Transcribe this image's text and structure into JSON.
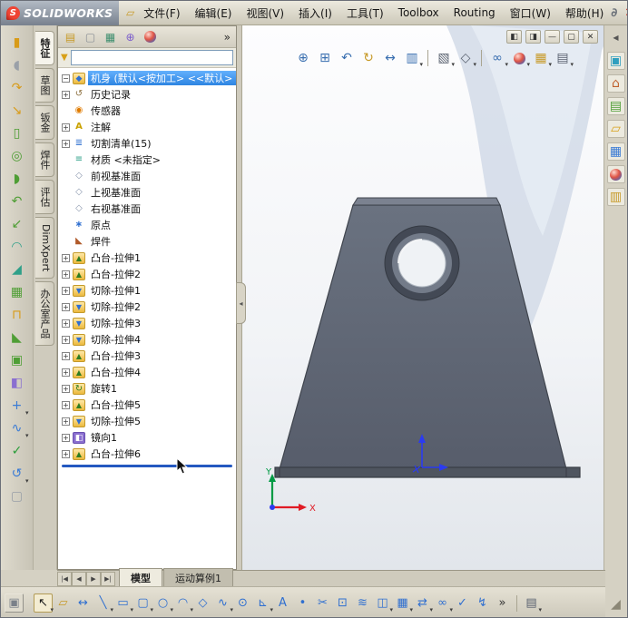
{
  "titlebar": {
    "brand_mark": "S",
    "brand": "SOLIDWORKS",
    "doc_icon_glyph": "▱",
    "menus": [
      "文件(F)",
      "编辑(E)",
      "视图(V)",
      "插入(I)",
      "工具(T)",
      "Toolbox",
      "Routing",
      "窗口(W)",
      "帮助(H)"
    ],
    "app_icon_glyph": "∂",
    "close_glyph": "✕"
  },
  "doc_controls": [
    {
      "name": "window-left-icon",
      "glyph": "◧"
    },
    {
      "name": "window-right-icon",
      "glyph": "◨"
    },
    {
      "name": "minimize-doc-icon",
      "glyph": "—"
    },
    {
      "name": "restore-doc-icon",
      "glyph": "▢"
    },
    {
      "name": "close-doc-icon",
      "glyph": "✕"
    }
  ],
  "manager_tabs": [
    {
      "name": "featuremanager-tab-icon",
      "glyph": "▤",
      "color": "#c79a28"
    },
    {
      "name": "propertymanager-tab-icon",
      "glyph": "▢",
      "color": "#8a8f96"
    },
    {
      "name": "configurationmanager-tab-icon",
      "glyph": "▦",
      "color": "#3f8f6f"
    },
    {
      "name": "dimxpertmanager-tab-icon",
      "glyph": "⊕",
      "color": "#7b5ccc"
    },
    {
      "name": "displaymanager-tab-icon",
      "glyph": "●",
      "cls": "ball"
    }
  ],
  "panel": {
    "overflow": "»",
    "filter_value": "",
    "filter_icon_glyph": "▼",
    "splitter_glyph": "◂"
  },
  "side_tabs": [
    "特征",
    "草图",
    "钣金",
    "焊件",
    "评估",
    "DimXpert",
    "办公室产品"
  ],
  "feature_tree": {
    "root": "机身 (默认<按加工> <<默认>",
    "items": [
      {
        "label": "历史记录",
        "icon": "history-icon",
        "expandable": true
      },
      {
        "label": "传感器",
        "icon": "sensors-icon",
        "expandable": false
      },
      {
        "label": "注解",
        "icon": "annotations-icon",
        "expandable": true
      },
      {
        "label": "切割清单(15)",
        "icon": "cutlist-icon",
        "expandable": true
      },
      {
        "label": "材质 <未指定>",
        "icon": "material-icon",
        "expandable": false
      },
      {
        "label": "前视基准面",
        "icon": "plane-icon",
        "expandable": false
      },
      {
        "label": "上视基准面",
        "icon": "plane-icon",
        "expandable": false
      },
      {
        "label": "右视基准面",
        "icon": "plane-icon",
        "expandable": false
      },
      {
        "label": "原点",
        "icon": "origin-icon",
        "expandable": false
      },
      {
        "label": "焊件",
        "icon": "weldment-icon",
        "expandable": false
      },
      {
        "label": "凸台-拉伸1",
        "icon": "boss-extrude-icon",
        "expandable": true
      },
      {
        "label": "凸台-拉伸2",
        "icon": "boss-extrude-icon",
        "expandable": true
      },
      {
        "label": "切除-拉伸1",
        "icon": "cut-extrude-icon",
        "expandable": true
      },
      {
        "label": "切除-拉伸2",
        "icon": "cut-extrude-icon",
        "expandable": true
      },
      {
        "label": "切除-拉伸3",
        "icon": "cut-extrude-icon",
        "expandable": true
      },
      {
        "label": "切除-拉伸4",
        "icon": "cut-extrude-icon",
        "expandable": true
      },
      {
        "label": "凸台-拉伸3",
        "icon": "boss-extrude-icon",
        "expandable": true
      },
      {
        "label": "凸台-拉伸4",
        "icon": "boss-extrude-icon",
        "expandable": true
      },
      {
        "label": "旋转1",
        "icon": "revolve-icon",
        "expandable": true
      },
      {
        "label": "凸台-拉伸5",
        "icon": "boss-extrude-icon",
        "expandable": true
      },
      {
        "label": "切除-拉伸5",
        "icon": "cut-extrude-icon",
        "expandable": true
      },
      {
        "label": "镜向1",
        "icon": "mirror-icon",
        "expandable": true
      },
      {
        "label": "凸台-拉伸6",
        "icon": "boss-extrude-icon",
        "expandable": true
      }
    ]
  },
  "left_toolbar": [
    {
      "name": "extruded-boss-icon",
      "glyph": "▮",
      "color": "#d89b18"
    },
    {
      "name": "revolved-boss-icon",
      "glyph": "◖",
      "color": "#9aa0a8"
    },
    {
      "name": "swept-boss-icon",
      "glyph": "↷",
      "color": "#d89b18"
    },
    {
      "name": "lofted-boss-icon",
      "glyph": "↘",
      "color": "#d89b18"
    },
    {
      "name": "extruded-cut-icon",
      "glyph": "▯",
      "color": "#4f9e35"
    },
    {
      "name": "hole-wizard-icon",
      "glyph": "◎",
      "color": "#4f9e35"
    },
    {
      "name": "revolved-cut-icon",
      "glyph": "◗",
      "color": "#4f9e35"
    },
    {
      "name": "swept-cut-icon",
      "glyph": "↶",
      "color": "#4f9e35"
    },
    {
      "name": "lofted-cut-icon",
      "glyph": "↙",
      "color": "#4f9e35"
    },
    {
      "name": "fillet-icon",
      "glyph": "◠",
      "color": "#2fa089"
    },
    {
      "name": "chamfer-icon",
      "glyph": "◢",
      "color": "#2fa089"
    },
    {
      "name": "linear-pattern-icon",
      "glyph": "▦",
      "color": "#4f9e35"
    },
    {
      "name": "rib-icon",
      "glyph": "⊓",
      "color": "#d89b18"
    },
    {
      "name": "draft-icon",
      "glyph": "◣",
      "color": "#4f9e35"
    },
    {
      "name": "shell-icon",
      "glyph": "▣",
      "color": "#4f9e35"
    },
    {
      "name": "mirror-feature-icon",
      "glyph": "◧",
      "color": "#8a6fd0"
    },
    {
      "name": "reference-geometry-icon",
      "glyph": "+",
      "color": "#3a7bd5",
      "dd": true
    },
    {
      "name": "curves-icon",
      "glyph": "∿",
      "color": "#3a7bd5",
      "dd": true
    },
    {
      "name": "instant3d-icon",
      "glyph": "✓",
      "color": "#2a9d3a"
    },
    {
      "name": "helix-icon",
      "glyph": "↺",
      "color": "#3a7bd5",
      "dd": true
    },
    {
      "name": "surface-icon",
      "glyph": "▢",
      "color": "#9aa0a8"
    }
  ],
  "view_toolbar": [
    {
      "name": "zoom-to-fit-icon",
      "glyph": "⊕",
      "color": "#3a6fb0"
    },
    {
      "name": "zoom-to-area-icon",
      "glyph": "⊞",
      "color": "#3a6fb0"
    },
    {
      "name": "previous-view-icon",
      "glyph": "↶",
      "color": "#3a6fb0"
    },
    {
      "name": "rotate-view-icon",
      "glyph": "↻",
      "color": "#c79a28"
    },
    {
      "name": "pan-icon",
      "glyph": "↔",
      "color": "#3a6fb0"
    },
    {
      "name": "section-view-icon",
      "glyph": "▥",
      "color": "#3a6fb0",
      "dd": true
    },
    {
      "sep": true
    },
    {
      "name": "view-orientation-icon",
      "glyph": "▧",
      "color": "#5a6270",
      "dd": true
    },
    {
      "name": "display-style-icon",
      "glyph": "◇",
      "color": "#5a6270",
      "dd": true
    },
    {
      "sep": true
    },
    {
      "name": "hide-show-items-icon",
      "glyph": "∞",
      "color": "#3a6fb0",
      "dd": true
    },
    {
      "name": "edit-appearance-icon",
      "glyph": "●",
      "cls": "ball",
      "dd": true
    },
    {
      "name": "apply-scene-icon",
      "glyph": "▦",
      "color": "#c79a28",
      "dd": true
    },
    {
      "name": "view-settings-icon",
      "glyph": "▤",
      "color": "#5a6270",
      "dd": true
    }
  ],
  "task_pane": [
    {
      "name": "collapse-task-pane-icon",
      "glyph": "◀",
      "color": "#555555",
      "cls": "flat"
    },
    {
      "name": "solidworks-resources-icon",
      "glyph": "▣",
      "color": "#2f9fbf"
    },
    {
      "name": "home-icon",
      "glyph": "⌂",
      "color": "#c0622f"
    },
    {
      "name": "design-library-icon",
      "glyph": "▤",
      "color": "#4f9e35"
    },
    {
      "name": "file-explorer-icon",
      "glyph": "▱",
      "color": "#d8a018"
    },
    {
      "name": "view-palette-icon",
      "glyph": "▦",
      "color": "#3a7bd5"
    },
    {
      "name": "appearances-icon",
      "glyph": "●",
      "cls": "ball"
    },
    {
      "name": "custom-properties-icon",
      "glyph": "▥",
      "color": "#c79a28"
    },
    {
      "name": "resize-grip-icon",
      "glyph": "◢",
      "color": "#8a8675",
      "cls": "footer"
    }
  ],
  "viewport": {
    "triad": {
      "x_label": "X",
      "y_label": "Y"
    }
  },
  "tab_scroll": [
    "|◀",
    "◀",
    "▶",
    "▶|"
  ],
  "bottom_tabs": [
    {
      "label": "模型",
      "active": true
    },
    {
      "label": "运动算例1",
      "active": false
    }
  ],
  "bottom_toolbar": [
    {
      "name": "reference-box-icon",
      "glyph": "▣",
      "color": "#7a8089",
      "cls": "corner"
    },
    {
      "name": "select-arrow-icon",
      "glyph": "↖",
      "color": "#1a1a1a",
      "cls": "pressed",
      "dd": true
    },
    {
      "name": "sketch-icon",
      "glyph": "▱",
      "color": "#c79a28"
    },
    {
      "name": "smart-dimension-icon",
      "glyph": "↔",
      "color": "#2f6fd0"
    },
    {
      "name": "line-icon",
      "glyph": "╲",
      "color": "#2f6fd0",
      "dd": true
    },
    {
      "name": "rectangle-icon",
      "glyph": "▭",
      "color": "#2f6fd0",
      "dd": true
    },
    {
      "name": "slot-icon",
      "glyph": "▢",
      "color": "#2f6fd0",
      "dd": true
    },
    {
      "name": "circle-icon",
      "glyph": "○",
      "color": "#2f6fd0",
      "dd": true
    },
    {
      "name": "arc-icon",
      "glyph": "◠",
      "color": "#2f6fd0",
      "dd": true
    },
    {
      "name": "polygon-icon",
      "glyph": "◇",
      "color": "#2f6fd0"
    },
    {
      "name": "spline-icon",
      "glyph": "∿",
      "color": "#2f6fd0",
      "dd": true
    },
    {
      "name": "ellipse-icon",
      "glyph": "⊙",
      "color": "#2f6fd0"
    },
    {
      "name": "sketch-fillet-icon",
      "glyph": "⊾",
      "color": "#2f6fd0",
      "dd": true
    },
    {
      "name": "text-icon",
      "glyph": "A",
      "color": "#2f6fd0"
    },
    {
      "name": "point-icon",
      "glyph": "•",
      "color": "#2f6fd0"
    },
    {
      "name": "trim-entities-icon",
      "glyph": "✂",
      "color": "#2f6fd0"
    },
    {
      "name": "convert-entities-icon",
      "glyph": "⊡",
      "color": "#2f6fd0"
    },
    {
      "name": "offset-entities-icon",
      "glyph": "≋",
      "color": "#2f6fd0"
    },
    {
      "name": "mirror-entities-icon",
      "glyph": "◫",
      "color": "#2f6fd0",
      "dd": true
    },
    {
      "name": "linear-sketch-pattern-icon",
      "glyph": "▦",
      "color": "#2f6fd0",
      "dd": true
    },
    {
      "name": "move-entities-icon",
      "glyph": "⇄",
      "color": "#2f6fd0",
      "dd": true
    },
    {
      "name": "display-relations-icon",
      "glyph": "∞",
      "color": "#2f6fd0",
      "dd": true
    },
    {
      "name": "repair-sketch-icon",
      "glyph": "✓",
      "color": "#2f6fd0"
    },
    {
      "name": "rapid-sketch-icon",
      "glyph": "↯",
      "color": "#2f6fd0"
    },
    {
      "name": "toolbar-overflow-icon",
      "glyph": "»",
      "color": "#333333",
      "cls": "chev"
    },
    {
      "sep": true
    },
    {
      "name": "options-icon",
      "glyph": "▤",
      "color": "#5a6270",
      "dd": true
    }
  ]
}
